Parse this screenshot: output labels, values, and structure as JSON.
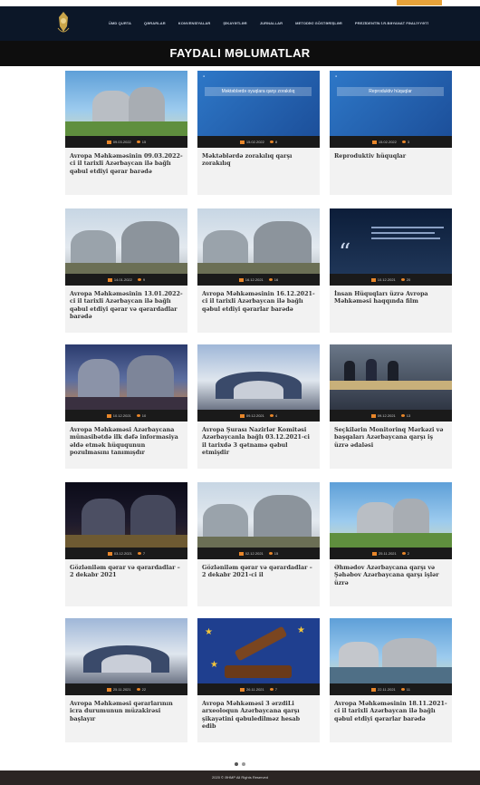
{
  "topbar": {
    "email": "",
    "phone": "",
    "lang_button": ""
  },
  "nav": {
    "items": [
      "ÜMD QURTA",
      "QƏRARLAR",
      "KONVENSİYALAR",
      "ŞİKAYƏTLƏR",
      "JURNALLAR",
      "METODİKİ GÖSTƏRİŞLƏR",
      "PREZİDENTİN İ.R.BƏYANAT FƏALİYYƏTİ"
    ]
  },
  "banner": {
    "title": "FAYDALI MƏLUMATLAR"
  },
  "cards": [
    {
      "date": "09.03.2022",
      "views": "15",
      "title": "Avropa Məhkəməsinin 09.03.2022-ci il tarixli Azərbaycan ilə bağlı qəbul etdiyi qərar barədə",
      "scene": "court-day",
      "slide_text": ""
    },
    {
      "date": "15.02.2022",
      "views": "8",
      "title": "Məktəblərdə zorakılıq qarşı zorakılıq",
      "scene": "slide",
      "slide_text": "Məktəblərdə oyuqlara qarşı zorakılıq"
    },
    {
      "date": "15.02.2022",
      "views": "3",
      "title": "Reproduktiv hüquqlar",
      "scene": "slide",
      "slide_text": "Reproduktiv hüquqlar"
    },
    {
      "date": "14.01.2022",
      "views": "9",
      "title": "Avropa Məhkəməsinin 13.01.2022-ci il tarixli Azərbaycan ilə bağlı qəbul etdiyi qərar və qərardadlar barədə",
      "scene": "court-cloud",
      "slide_text": ""
    },
    {
      "date": "16.12.2021",
      "views": "16",
      "title": "Avropa Məhkəməsinin 16.12.2021-ci il tarixli Azərbaycan ilə bağlı qəbul etdiyi qərarlar barədə",
      "scene": "court-cloud",
      "slide_text": ""
    },
    {
      "date": "10.12.2021",
      "views": "20",
      "title": "İnsan Hüquqları üzrə Avropa Məhkəməsi haqqında film",
      "scene": "quote-dark",
      "slide_text": ""
    },
    {
      "date": "10.12.2021",
      "views": "10",
      "title": "Avropa Məhkəməsi Azərbaycana münasibətdə ilk dəfə informasiya əldə etmək hüququnun pozulmasını tanımışdır",
      "scene": "court-eve",
      "slide_text": ""
    },
    {
      "date": "09.12.2021",
      "views": "4",
      "title": "Avropa Şurası Nazirlər Komitəsi Azərbaycanla bağlı 03.12.2021-ci il tarixdə 3 qətnamə qəbul etmişdir",
      "scene": "hall",
      "slide_text": ""
    },
    {
      "date": "09.12.2021",
      "views": "13",
      "title": "Seçkilərin Monitorinq Mərkəzi və başqaları Azərbaycana qarşı iş üzrə ədaləsi",
      "scene": "meeting",
      "slide_text": ""
    },
    {
      "date": "03.12.2021",
      "views": "7",
      "title": "Gözləniləm qərar və qərardadlar – 2 dekabr 2021",
      "scene": "court-night",
      "slide_text": ""
    },
    {
      "date": "02.12.2021",
      "views": "15",
      "title": "Gözləniləm qərar və qərardadlar – 2 dekabr 2021-ci il",
      "scene": "court-cloud",
      "slide_text": ""
    },
    {
      "date": "25.11.2021",
      "views": "2",
      "title": "Əhmədov Azərbaycana qarşı və Şəhəbov Azərbaycana qarşı işlər üzrə",
      "scene": "court-day",
      "slide_text": ""
    },
    {
      "date": "25.11.2021",
      "views": "22",
      "title": "Avropa Məhkəməsi qərarlarının icra durumunun müzakirəsi başlayır",
      "scene": "hall",
      "slide_text": ""
    },
    {
      "date": "26.11.2021",
      "views": "7",
      "title": "Avropa Məhkəməsi 3 ərzdiLi arxeoloqun Azərbaycana qarşı şikayətini qəbuledilməz hesab edib",
      "scene": "gavel",
      "slide_text": ""
    },
    {
      "date": "22.11.2021",
      "views": "11",
      "title": "Avropa Məhkəməsinin 18.11.2021-ci il tarixli Azərbaycan ilə bağlı qəbul etdiyi qərarlar barədə",
      "scene": "court-river",
      "slide_text": ""
    }
  ],
  "pager": {
    "pages": 2,
    "current": 1
  },
  "footer": {
    "text": "2020 © ƏHMP All Rights Reserved"
  },
  "colors": {
    "navbar": "#0c1728",
    "banner": "#0e0e0e",
    "meta_bar": "#1a1a1a",
    "accent": "#e8862a",
    "footer": "#2b2523"
  }
}
